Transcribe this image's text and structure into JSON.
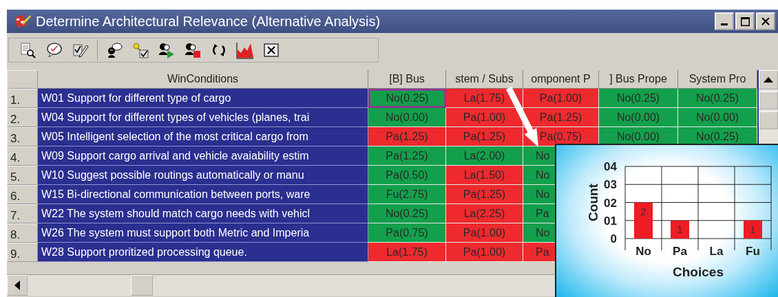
{
  "window": {
    "title": "Determine Architectural Relevance (Alternative Analysis)"
  },
  "table": {
    "columns": [
      "WinConditions",
      "[B] Bus",
      "stem / Subs",
      "omponent P",
      "] Bus Prope",
      "System Pro"
    ],
    "rows": [
      {
        "number": "1.",
        "cells": [
          {
            "kind": "condition",
            "text": "W01 Support for different type of cargo"
          },
          {
            "kind": "rating",
            "text": "No(0.25)",
            "color": "#13a04c",
            "selected": true
          },
          {
            "kind": "rating",
            "text": "La(1.75)",
            "color": "#ee2a2e",
            "selected": false
          },
          {
            "kind": "rating",
            "text": "Pa(1.00)",
            "color": "#ee2a2e",
            "selected": false
          },
          {
            "kind": "rating",
            "text": "No(0.25)",
            "color": "#13a04c",
            "selected": false
          },
          {
            "kind": "rating",
            "text": "No(0.25)",
            "color": "#13a04c",
            "selected": false
          }
        ]
      },
      {
        "number": "2.",
        "cells": [
          {
            "kind": "condition",
            "text": "W04 Support for different types of vehicles (planes, trai"
          },
          {
            "kind": "rating",
            "text": "No(0.00)",
            "color": "#13a04c",
            "selected": false
          },
          {
            "kind": "rating",
            "text": "Pa(1.00)",
            "color": "#ee2a2e",
            "selected": false
          },
          {
            "kind": "rating",
            "text": "Pa(1.25)",
            "color": "#ee2a2e",
            "selected": false
          },
          {
            "kind": "rating",
            "text": "No(0.00)",
            "color": "#13a04c",
            "selected": false
          },
          {
            "kind": "rating",
            "text": "No(0.00)",
            "color": "#13a04c",
            "selected": false
          }
        ]
      },
      {
        "number": "3.",
        "cells": [
          {
            "kind": "condition",
            "text": "W05 Intelligent selection of the most critical cargo from"
          },
          {
            "kind": "rating",
            "text": "Pa(1.25)",
            "color": "#ee2a2e",
            "selected": false
          },
          {
            "kind": "rating",
            "text": "Pa(1.25)",
            "color": "#ee2a2e",
            "selected": false
          },
          {
            "kind": "rating",
            "text": "Pa(0.75)",
            "color": "#ee2a2e",
            "selected": false
          },
          {
            "kind": "rating",
            "text": "No(0.00)",
            "color": "#13a04c",
            "selected": false
          },
          {
            "kind": "rating",
            "text": "No(0.25)",
            "color": "#13a04c",
            "selected": false
          }
        ]
      },
      {
        "number": "4.",
        "cells": [
          {
            "kind": "condition",
            "text": "W09 Support cargo arrival and vehicle avaiability estim"
          },
          {
            "kind": "rating",
            "text": "Pa(1.25)",
            "color": "#13a04c",
            "selected": false
          },
          {
            "kind": "rating",
            "text": "La(2.00)",
            "color": "#13a04c",
            "selected": false
          },
          {
            "kind": "rating",
            "text": "No",
            "color": "#13a04c",
            "selected": false
          }
        ]
      },
      {
        "number": "5.",
        "cells": [
          {
            "kind": "condition",
            "text": "W10 Suggest possible routings automatically or manu"
          },
          {
            "kind": "rating",
            "text": "Pa(0.50)",
            "color": "#13a04c",
            "selected": false
          },
          {
            "kind": "rating",
            "text": "La(1.50)",
            "color": "#ee2a2e",
            "selected": false
          },
          {
            "kind": "rating",
            "text": "No",
            "color": "#13a04c",
            "selected": false
          }
        ]
      },
      {
        "number": "6.",
        "cells": [
          {
            "kind": "condition",
            "text": "W15 Bi-directional communication between ports, ware"
          },
          {
            "kind": "rating",
            "text": "Fu(2.75)",
            "color": "#13a04c",
            "selected": false
          },
          {
            "kind": "rating",
            "text": "Pa(1.25)",
            "color": "#ee2a2e",
            "selected": false
          },
          {
            "kind": "rating",
            "text": "No",
            "color": "#13a04c",
            "selected": false
          }
        ]
      },
      {
        "number": "7.",
        "cells": [
          {
            "kind": "condition",
            "text": "W22 The system should match cargo needs with vehicl"
          },
          {
            "kind": "rating",
            "text": "No(0.25)",
            "color": "#13a04c",
            "selected": false
          },
          {
            "kind": "rating",
            "text": "La(2.25)",
            "color": "#ee2a2e",
            "selected": false
          },
          {
            "kind": "rating",
            "text": "Pa",
            "color": "#13a04c",
            "selected": false
          }
        ]
      },
      {
        "number": "8.",
        "cells": [
          {
            "kind": "condition",
            "text": "W26 The system must support both Metric and Imperia"
          },
          {
            "kind": "rating",
            "text": "Pa(0.75)",
            "color": "#13a04c",
            "selected": false
          },
          {
            "kind": "rating",
            "text": "Pa(1.00)",
            "color": "#ee2a2e",
            "selected": false
          },
          {
            "kind": "rating",
            "text": "No",
            "color": "#13a04c",
            "selected": false
          }
        ]
      },
      {
        "number": "9.",
        "cells": [
          {
            "kind": "condition",
            "text": "W28 Support proritized processing queue."
          },
          {
            "kind": "rating",
            "text": "La(1.75)",
            "color": "#ee2a2e",
            "selected": false
          },
          {
            "kind": "rating",
            "text": "Pa(1.00)",
            "color": "#ee2a2e",
            "selected": false
          },
          {
            "kind": "rating",
            "text": "Pa",
            "color": "#ee2a2e",
            "selected": false
          }
        ]
      }
    ]
  },
  "callout": {
    "chart_data": {
      "type": "bar",
      "xlabel": "Choices",
      "ylabel": "Count",
      "categories": [
        "No",
        "Pa",
        "La",
        "Fu"
      ],
      "series": [
        {
          "color": "#ee1c25",
          "values": [
            2,
            1,
            0,
            1
          ]
        }
      ],
      "ylim": [
        0,
        4
      ],
      "yticks": [
        {
          "value": 0,
          "label": "0"
        },
        {
          "value": 1,
          "label": "01"
        },
        {
          "value": 2,
          "label": "02"
        },
        {
          "value": 3,
          "label": "03"
        },
        {
          "value": 4,
          "label": "04"
        }
      ],
      "grid": true,
      "value_labels": [
        "2",
        "1",
        null,
        "1"
      ]
    }
  }
}
